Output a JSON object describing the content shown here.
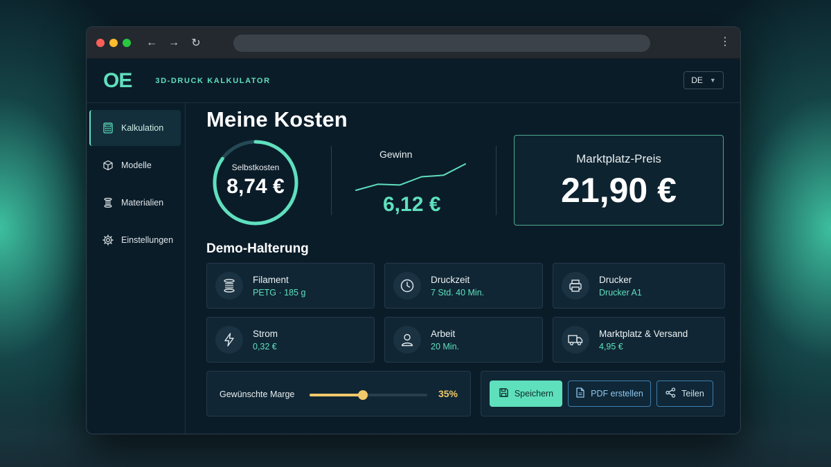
{
  "app": {
    "logo": "OE",
    "name": "3D-DRUCK KALKULATOR",
    "language": "DE"
  },
  "sidebar": {
    "items": [
      {
        "label": "Kalkulation",
        "icon": "calculator-icon",
        "active": true
      },
      {
        "label": "Modelle",
        "icon": "cube-icon",
        "active": false
      },
      {
        "label": "Materialien",
        "icon": "spool-icon",
        "active": false
      },
      {
        "label": "Einstellungen",
        "icon": "gear-icon",
        "active": false
      }
    ]
  },
  "main": {
    "title": "Meine Kosten",
    "cost": {
      "label": "Selbstkosten",
      "value": "8,74 €",
      "ring_fraction": 0.85
    },
    "profit": {
      "label": "Gewinn",
      "value": "6,12 €",
      "trend": [
        10,
        18,
        17,
        28,
        30,
        45
      ]
    },
    "market": {
      "label": "Marktplatz-Preis",
      "value": "21,90 €"
    },
    "model_name": "Demo-Halterung",
    "cards": [
      {
        "title": "Filament",
        "value": "PETG · 185 g",
        "icon": "spool-icon"
      },
      {
        "title": "Druckzeit",
        "value": "7 Std. 40 Min.",
        "icon": "clock-icon"
      },
      {
        "title": "Drucker",
        "value": "Drucker A1",
        "icon": "printer-icon"
      },
      {
        "title": "Strom",
        "value": "0,32 €",
        "icon": "lightning-icon"
      },
      {
        "title": "Arbeit",
        "value": "20 Min.",
        "icon": "user-icon"
      },
      {
        "title": "Marktplatz & Versand",
        "value": "4,95 €",
        "icon": "truck-icon"
      }
    ],
    "margin": {
      "label": "Gewünschte Marge",
      "value": "35%",
      "fraction": 0.45
    },
    "actions": {
      "save": "Speichern",
      "pdf": "PDF erstellen",
      "share": "Teilen"
    }
  },
  "colors": {
    "accent": "#5fe0bd",
    "highlight": "#f1c96a",
    "background": "#0b1c29"
  }
}
